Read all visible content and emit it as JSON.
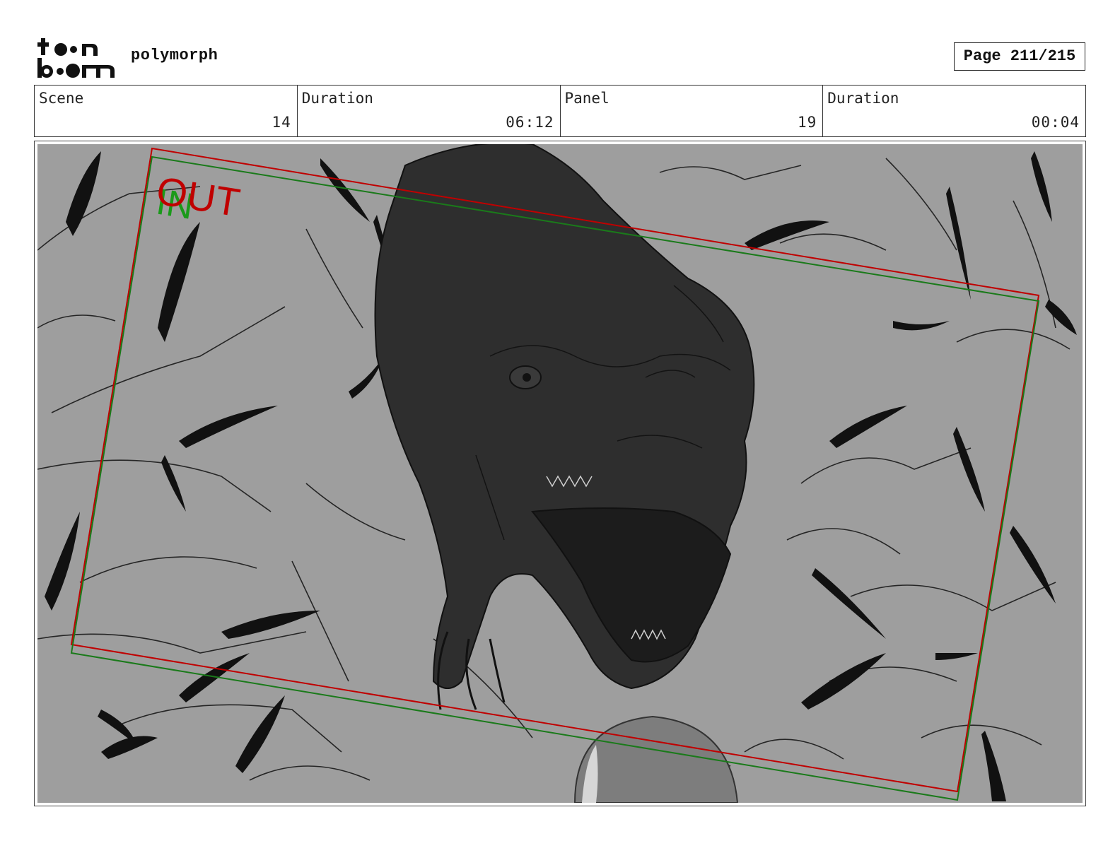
{
  "header": {
    "logo_line1": "toon",
    "logo_line2": "boom",
    "project_title": "polymorph",
    "page_indicator": "Page 211/215"
  },
  "info_bar": [
    {
      "label": "Scene",
      "value": "14"
    },
    {
      "label": "Duration",
      "value": "06:12"
    },
    {
      "label": "Panel",
      "value": "19"
    },
    {
      "label": "Duration",
      "value": "00:04"
    }
  ],
  "panel": {
    "out_label": "OUT",
    "in_label": "IN",
    "colors": {
      "background": "#9e9e9e",
      "creature": "#2e2e2e",
      "ink": "#111111",
      "out_frame": "#c00000",
      "in_frame": "#1a7a1a",
      "orb": "#7d7d7d"
    }
  }
}
